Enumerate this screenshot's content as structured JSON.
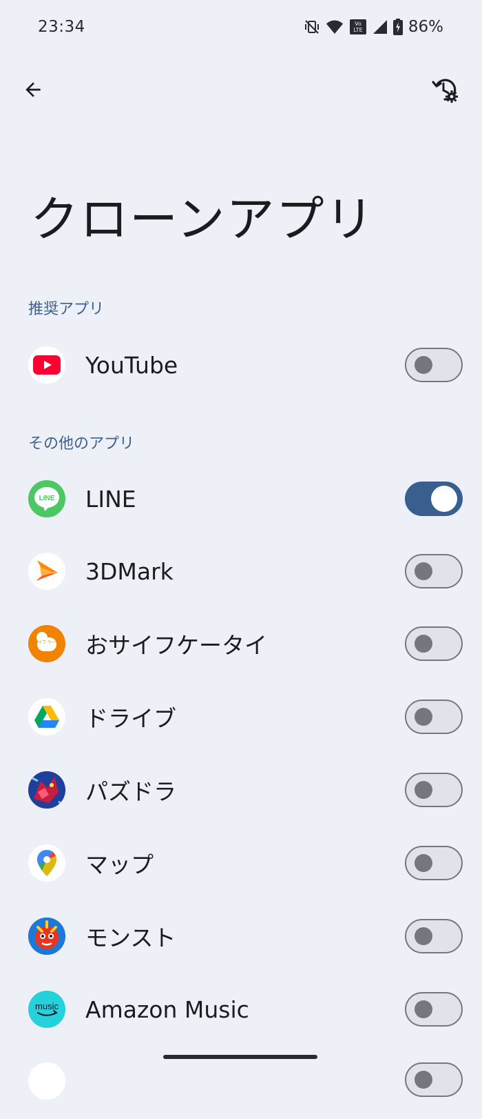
{
  "status_bar": {
    "time": "23:34",
    "battery": "86%"
  },
  "header": {
    "title": "クローンアプリ"
  },
  "sections": {
    "recommended": {
      "label": "推奨アプリ",
      "apps": [
        {
          "name": "YouTube",
          "icon": "youtube-icon",
          "enabled": false
        }
      ]
    },
    "other": {
      "label": "その他のアプリ",
      "apps": [
        {
          "name": "LINE",
          "icon": "line-icon",
          "enabled": true
        },
        {
          "name": "3DMark",
          "icon": "3dmark-icon",
          "enabled": false
        },
        {
          "name": "おサイフケータイ",
          "icon": "osaifu-keitai-icon",
          "enabled": false
        },
        {
          "name": "ドライブ",
          "icon": "google-drive-icon",
          "enabled": false
        },
        {
          "name": "パズドラ",
          "icon": "puzzle-dragons-icon",
          "enabled": false
        },
        {
          "name": "マップ",
          "icon": "google-maps-icon",
          "enabled": false
        },
        {
          "name": "モンスト",
          "icon": "monster-strike-icon",
          "enabled": false
        },
        {
          "name": "Amazon Music",
          "icon": "amazon-music-icon",
          "enabled": false
        }
      ]
    }
  },
  "icon_text": {
    "line": "LINE",
    "osaifu": "おサイフ ケータイ",
    "music": "music"
  },
  "colors": {
    "accent": "#395f8f",
    "section_header": "#3d5f8d",
    "background": "#eef0f7",
    "youtube_red": "#ff0033",
    "line_green": "#4cc764",
    "osaifu_orange": "#f08300",
    "amazon_music_teal": "#25d1da"
  }
}
